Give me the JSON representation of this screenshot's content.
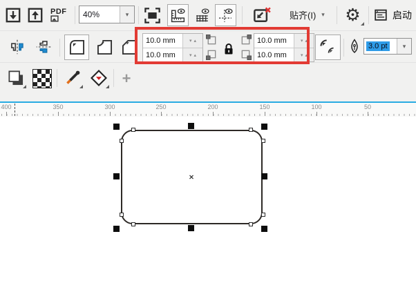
{
  "toolbar": {
    "pdf_label": "PDF",
    "zoom_level": "40%",
    "snap_label": "贴齐(I)",
    "launch_label": "启动"
  },
  "property_bar": {
    "corner_radius_top_left": "10.0 mm",
    "corner_radius_bottom_left": "10.0 mm",
    "corner_radius_top_right": "10.0 mm",
    "corner_radius_bottom_right": "10.0 mm",
    "outline_width": "3.0 pt"
  },
  "ruler": {
    "labels": [
      "400",
      "350",
      "300",
      "250",
      "200",
      "150",
      "100",
      "50"
    ]
  },
  "canvas": {
    "center_mark": "×"
  },
  "icons": {
    "spinner_down": "▾",
    "spinner_up": "▴",
    "dropdown": "▾",
    "plus": "+",
    "gear": "⚙"
  },
  "colors": {
    "highlight_red": "#e23b34",
    "selection_blue": "#2f9ce8",
    "ruler_line_blue": "#29abe2",
    "mirror_icon_blue": "#1e8bd0",
    "eyedropper_tip_orange": "#e2701c",
    "fill_arrow_red": "#cf1d1d"
  }
}
